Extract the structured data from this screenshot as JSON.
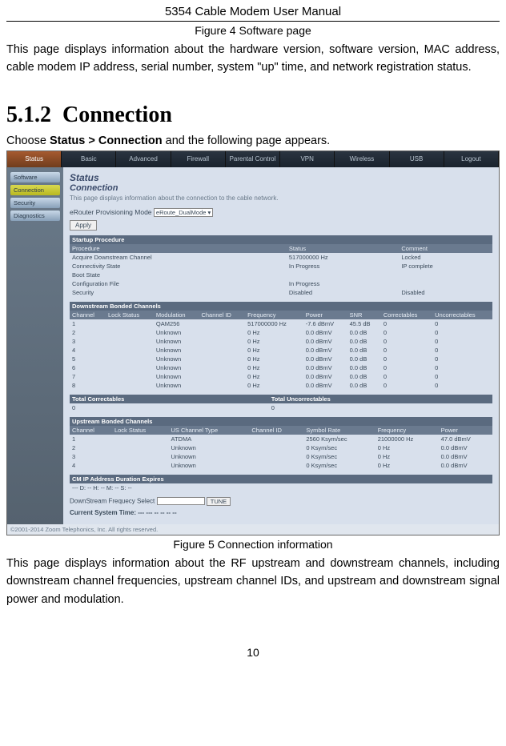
{
  "header": {
    "title": "5354 Cable Modem User Manual"
  },
  "figure4": "Figure 4 Software page",
  "intro_para": "This page displays information about the hardware version, software version, MAC address, cable modem IP address, serial number, system \"up\" time, and network registration status.",
  "section": {
    "number": "5.1.2",
    "title": "Connection"
  },
  "instruction": {
    "prefix": "Choose ",
    "bold": "Status > Connection",
    "suffix": " and the following page appears."
  },
  "screenshot": {
    "nav": [
      "Status",
      "Basic",
      "Advanced",
      "Firewall",
      "Parental Control",
      "VPN",
      "Wireless",
      "USB",
      "Logout"
    ],
    "sidebar": [
      "Software",
      "Connection",
      "Security",
      "Diagnostics"
    ],
    "status_title": "Status",
    "conn_title": "Connection",
    "page_desc": "This page displays information about the connection to the cable network.",
    "prov_label": "eRouter Provisioning Mode",
    "prov_value": "eRoute_DualMode ▾",
    "apply": "Apply",
    "startup": {
      "header": "Startup Procedure",
      "cols": [
        "Procedure",
        "Status",
        "Comment"
      ],
      "rows": [
        [
          "Acquire Downstream Channel",
          "517000000 Hz",
          "Locked"
        ],
        [
          "Connectivity State",
          "In Progress",
          "IP complete"
        ],
        [
          "Boot State",
          "",
          ""
        ],
        [
          "Configuration File",
          "In Progress",
          ""
        ],
        [
          "Security",
          "Disabled",
          "Disabled"
        ]
      ]
    },
    "downstream": {
      "header": "Downstream Bonded Channels",
      "cols": [
        "Channel",
        "Lock Status",
        "Modulation",
        "Channel ID",
        "Frequency",
        "Power",
        "SNR",
        "Correctables",
        "Uncorrectables"
      ],
      "rows": [
        [
          "1",
          "",
          "QAM256",
          "",
          "517000000 Hz",
          "-7.6 dBmV",
          "45.5 dB",
          "0",
          "0"
        ],
        [
          "2",
          "",
          "Unknown",
          "",
          "0 Hz",
          "0.0 dBmV",
          "0.0 dB",
          "0",
          "0"
        ],
        [
          "3",
          "",
          "Unknown",
          "",
          "0 Hz",
          "0.0 dBmV",
          "0.0 dB",
          "0",
          "0"
        ],
        [
          "4",
          "",
          "Unknown",
          "",
          "0 Hz",
          "0.0 dBmV",
          "0.0 dB",
          "0",
          "0"
        ],
        [
          "5",
          "",
          "Unknown",
          "",
          "0 Hz",
          "0.0 dBmV",
          "0.0 dB",
          "0",
          "0"
        ],
        [
          "6",
          "",
          "Unknown",
          "",
          "0 Hz",
          "0.0 dBmV",
          "0.0 dB",
          "0",
          "0"
        ],
        [
          "7",
          "",
          "Unknown",
          "",
          "0 Hz",
          "0.0 dBmV",
          "0.0 dB",
          "0",
          "0"
        ],
        [
          "8",
          "",
          "Unknown",
          "",
          "0 Hz",
          "0.0 dBmV",
          "0.0 dB",
          "0",
          "0"
        ]
      ]
    },
    "totals": {
      "cols": [
        "Total Correctables",
        "Total Uncorrectables"
      ],
      "row": [
        "0",
        "0"
      ]
    },
    "upstream": {
      "header": "Upstream Bonded Channels",
      "cols": [
        "Channel",
        "Lock Status",
        "US Channel Type",
        "Channel ID",
        "Symbol Rate",
        "Frequency",
        "Power"
      ],
      "rows": [
        [
          "1",
          "",
          "ATDMA",
          "",
          "2560 Ksym/sec",
          "21000000 Hz",
          "47.0 dBmV"
        ],
        [
          "2",
          "",
          "Unknown",
          "",
          "0 Ksym/sec",
          "0 Hz",
          "0.0 dBmV"
        ],
        [
          "3",
          "",
          "Unknown",
          "",
          "0 Ksym/sec",
          "0 Hz",
          "0.0 dBmV"
        ],
        [
          "4",
          "",
          "Unknown",
          "",
          "0 Ksym/sec",
          "0 Hz",
          "0.0 dBmV"
        ]
      ]
    },
    "cm_ip": {
      "labels": "CM IP Address    Duration          Expires",
      "value": "---    D: -- H: -- M: -- S: --"
    },
    "ds_freq": {
      "label": "DownStream Frequecy Select",
      "btn": "TUNE"
    },
    "cur_time_label": "Current System Time: --- --- -- -- -- --",
    "footer": "©2001-2014 Zoom Telephonics, Inc. All rights reserved."
  },
  "figure5": "Figure 5 Connection information",
  "outro_para": "This page displays information about the RF upstream and downstream channels, including downstream channel frequencies, upstream channel IDs, and upstream and downstream signal power and modulation.",
  "page_number": "10"
}
